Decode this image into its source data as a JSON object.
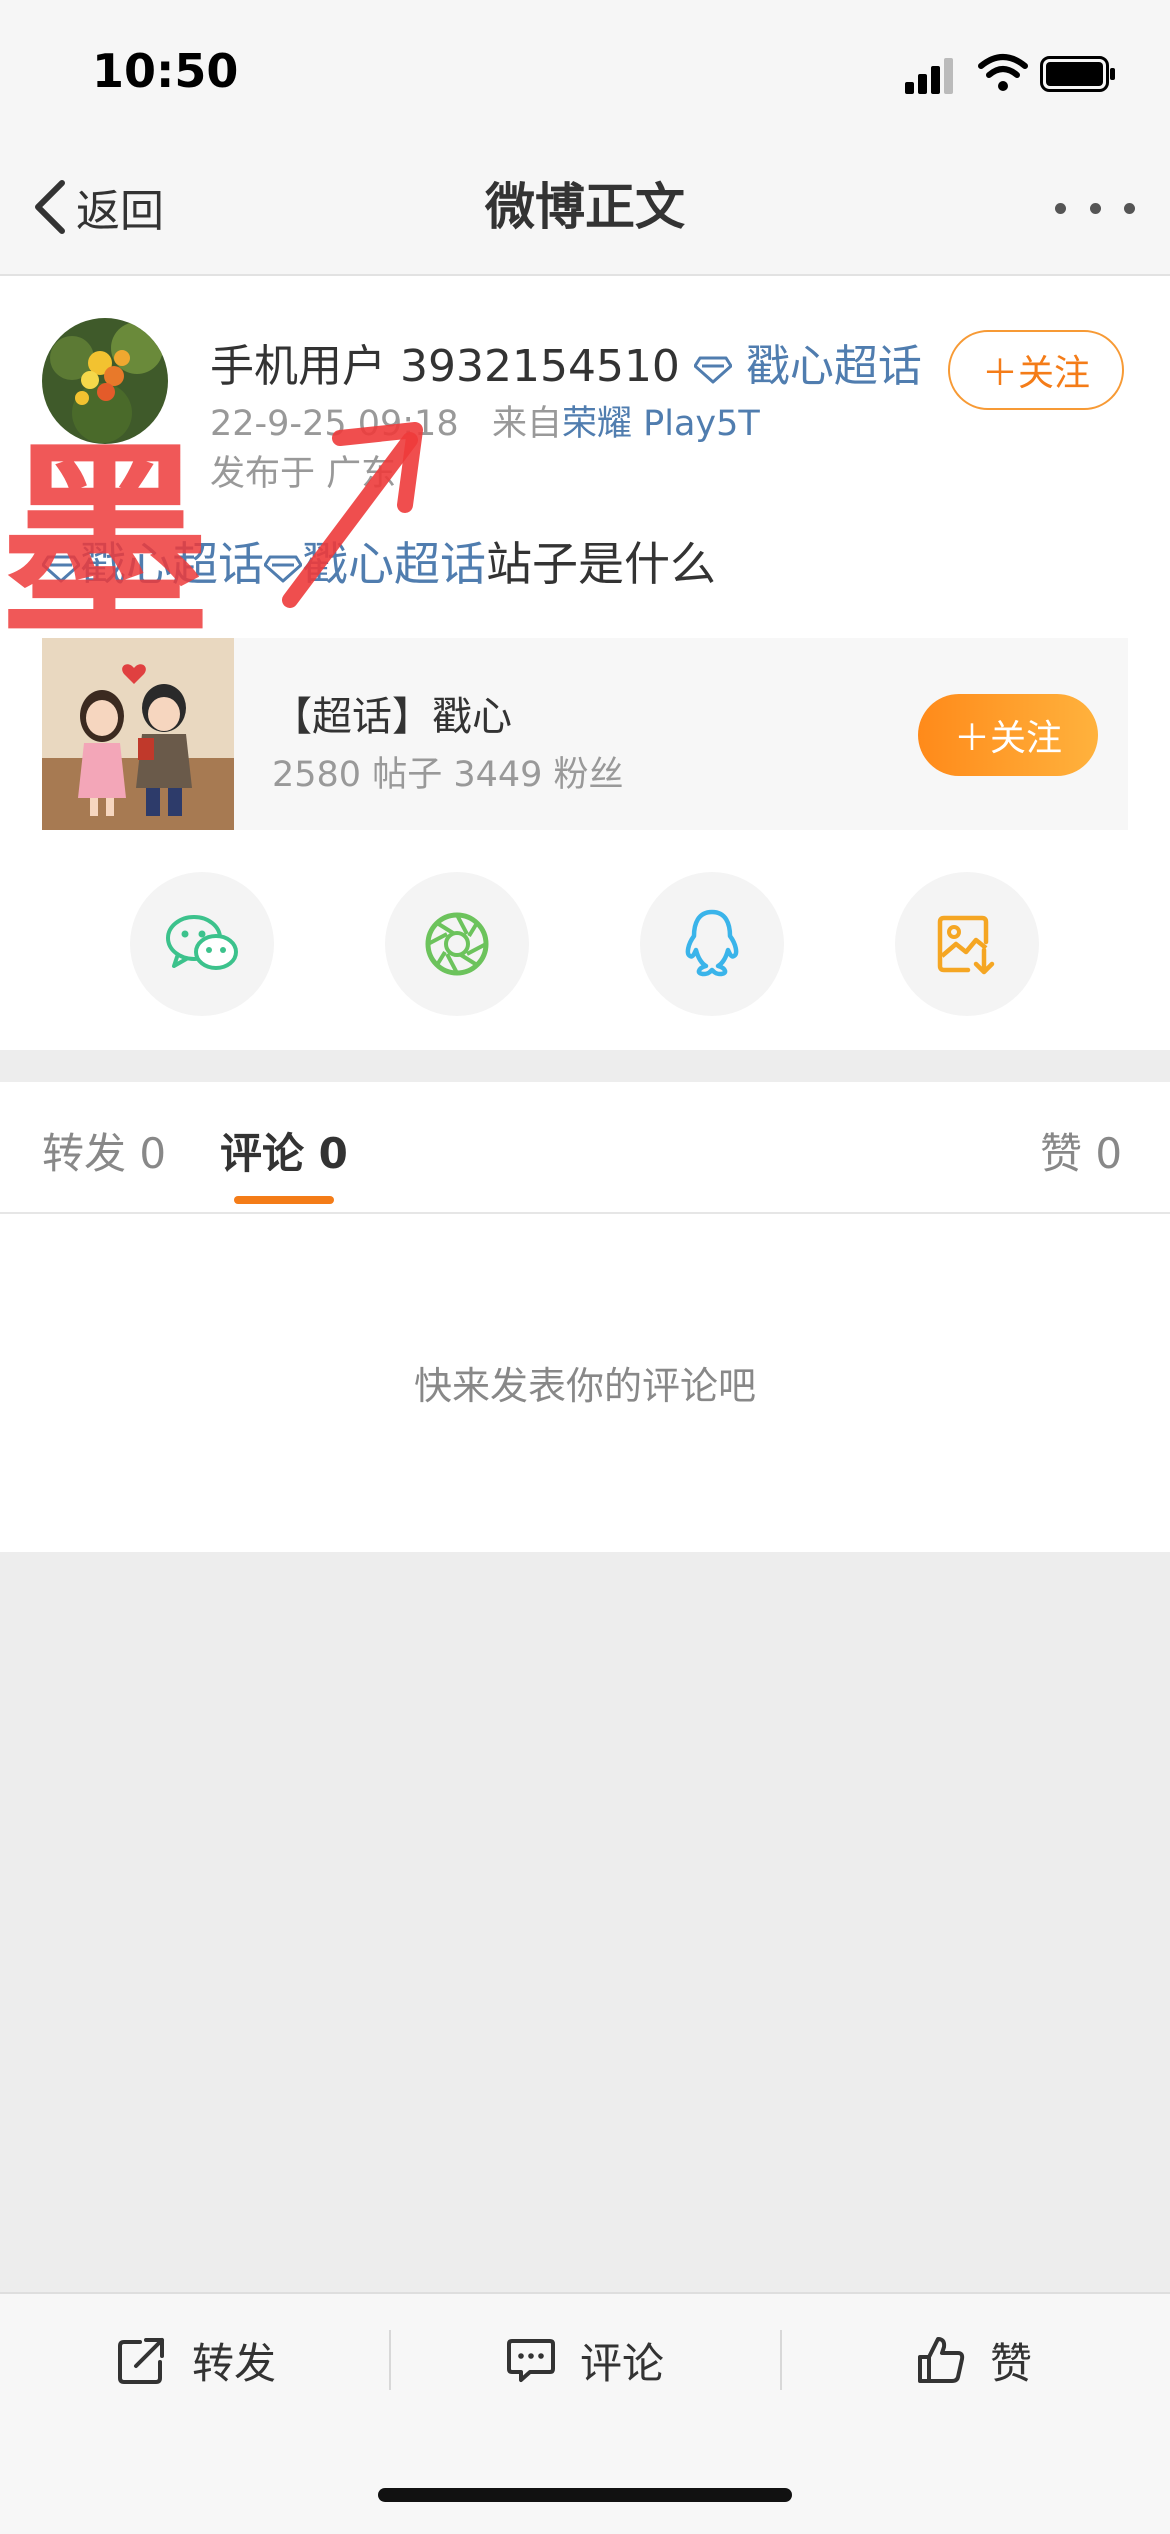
{
  "status_bar": {
    "time": "10:50"
  },
  "nav": {
    "back_label": "返回",
    "title": "微博正文"
  },
  "post": {
    "username": "手机用户 3932154510",
    "super_topic_badge": "戳心超话",
    "date": "22-9-25 09:18",
    "source_prefix": "来自",
    "source_device": "荣耀 Play5T",
    "location": "发布于 广东",
    "follow_label": "＋关注",
    "text_tag_1": "戳心超话",
    "text_tag_2": "戳心超话",
    "text_rest": "站子是什么"
  },
  "topic_card": {
    "name": "【超话】戳心",
    "stats": "2580 帖子  3449 粉丝",
    "follow_label": "＋关注"
  },
  "share": {
    "items": [
      {
        "icon": "wechat-icon",
        "color": "#3cc28c"
      },
      {
        "icon": "moments-icon",
        "color": "#6cc35c"
      },
      {
        "icon": "qq-icon",
        "color": "#3ab4ea"
      },
      {
        "icon": "save-image-icon",
        "color": "#f5a623"
      }
    ]
  },
  "tabs": {
    "repost": "转发 0",
    "comment": "评论 0",
    "like": "赞 0"
  },
  "comments": {
    "empty_text": "快来发表你的评论吧"
  },
  "bottom_bar": {
    "repost": "转发",
    "comment": "评论",
    "like": "赞"
  },
  "watermark": {
    "text": "墨"
  },
  "colors": {
    "accent": "#f47c18",
    "link": "#507daf",
    "watermark": "#ee3b3b"
  }
}
